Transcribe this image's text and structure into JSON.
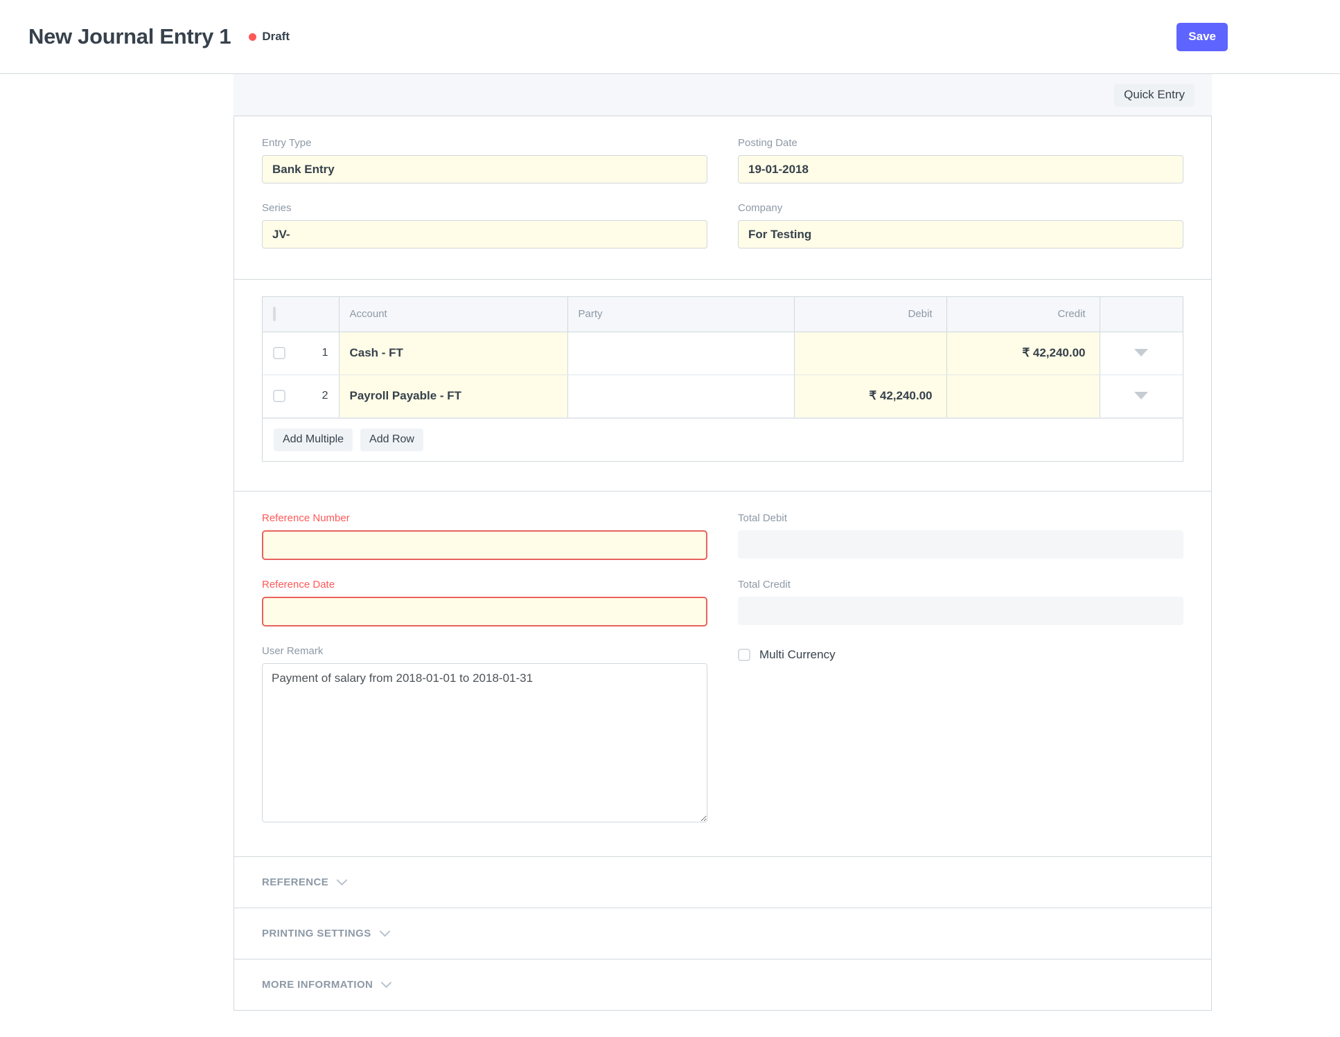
{
  "header": {
    "title": "New Journal Entry 1",
    "status": "Draft",
    "save_label": "Save"
  },
  "toolbar": {
    "quick_entry_label": "Quick Entry"
  },
  "fields": {
    "entry_type": {
      "label": "Entry Type",
      "value": "Bank Entry"
    },
    "posting_date": {
      "label": "Posting Date",
      "value": "19-01-2018"
    },
    "series": {
      "label": "Series",
      "value": "JV-"
    },
    "company": {
      "label": "Company",
      "value": "For Testing"
    }
  },
  "grid": {
    "columns": {
      "account": "Account",
      "party": "Party",
      "debit": "Debit",
      "credit": "Credit"
    },
    "rows": [
      {
        "idx": "1",
        "account": "Cash - FT",
        "party": "",
        "debit": "",
        "credit": "₹ 42,240.00"
      },
      {
        "idx": "2",
        "account": "Payroll Payable - FT",
        "party": "",
        "debit": "₹ 42,240.00",
        "credit": ""
      }
    ],
    "buttons": {
      "add_multiple": "Add Multiple",
      "add_row": "Add Row"
    }
  },
  "details": {
    "reference_number": {
      "label": "Reference Number",
      "value": ""
    },
    "reference_date": {
      "label": "Reference Date",
      "value": ""
    },
    "user_remark": {
      "label": "User Remark",
      "value": "Payment of salary from 2018-01-01 to 2018-01-31"
    },
    "total_debit": {
      "label": "Total Debit",
      "value": ""
    },
    "total_credit": {
      "label": "Total Credit",
      "value": ""
    },
    "multi_currency": {
      "label": "Multi Currency"
    }
  },
  "sections": [
    {
      "label": "REFERENCE"
    },
    {
      "label": "PRINTING SETTINGS"
    },
    {
      "label": "MORE INFORMATION"
    }
  ],
  "colors": {
    "primary": "#5e64ff",
    "danger": "#ff5858",
    "mandatory_bg": "#fffce7",
    "label_grey": "#8d99a6",
    "text": "#36414c",
    "border": "#d1d8dd",
    "band_bg": "#f5f7fa"
  }
}
